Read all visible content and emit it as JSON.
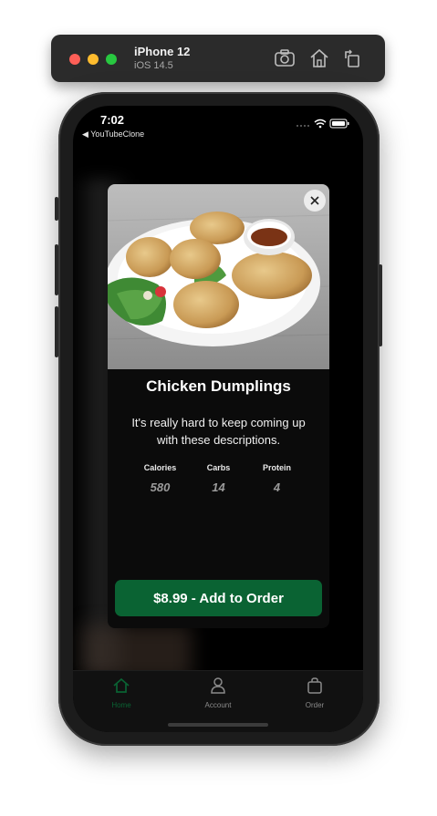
{
  "simulator": {
    "device_name": "iPhone 12",
    "os_version": "iOS 14.5",
    "icons": [
      "screenshot-icon",
      "home-icon",
      "rotate-icon"
    ]
  },
  "status_bar": {
    "time": "7:02",
    "back_label": "◀ YouTubeClone"
  },
  "modal": {
    "title": "Chicken Dumplings",
    "description": "It's really hard to keep coming up with these descriptions.",
    "nutrition": [
      {
        "label": "Calories",
        "value": "580"
      },
      {
        "label": "Carbs",
        "value": "14"
      },
      {
        "label": "Protein",
        "value": "4"
      }
    ],
    "order_button": "$8.99 - Add to Order"
  },
  "tab_bar": {
    "tabs": [
      {
        "label": "Home",
        "icon": "home-icon",
        "active": true
      },
      {
        "label": "Account",
        "icon": "person-icon",
        "active": false
      },
      {
        "label": "Order",
        "icon": "bag-icon",
        "active": false
      }
    ]
  },
  "colors": {
    "accent_green": "#0a6333",
    "active_tab": "#0a6333",
    "inactive_tab": "#8a8a8a",
    "card_background": "#0b0b0b"
  }
}
